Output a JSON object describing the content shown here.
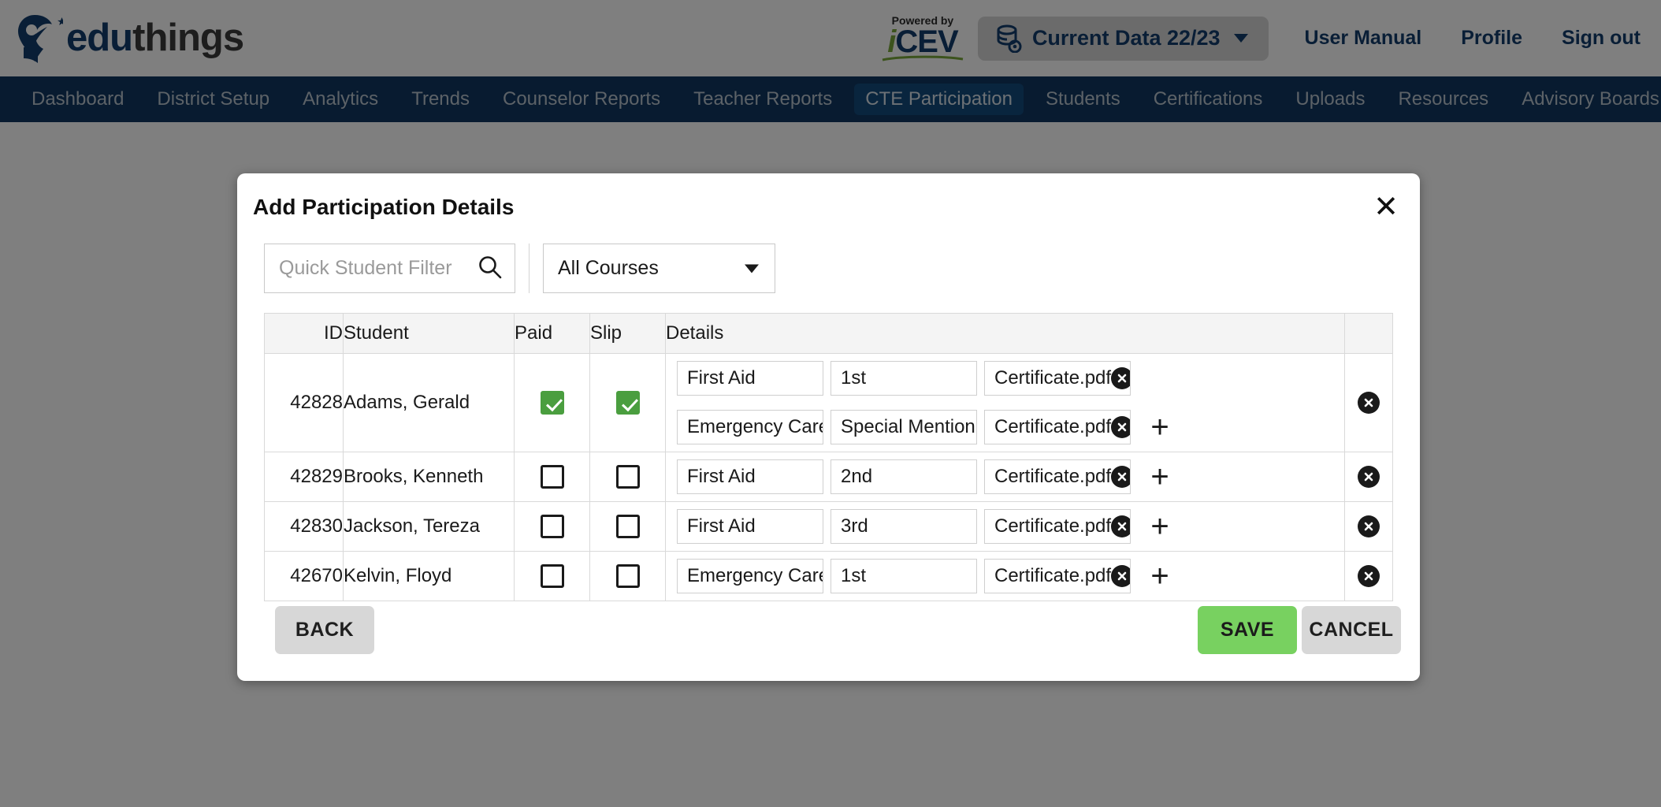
{
  "header": {
    "logo_text_blue": "edu",
    "logo_text_dark": "things",
    "logo_icon": "eduthings-pin-book-logo",
    "powered_by": "Powered by",
    "icev_i": "i",
    "icev_cev": "CEV",
    "data_selector": {
      "label": "Current Data 22/23",
      "icon": "database-view-icon",
      "caret": "chevron-down-icon"
    },
    "links": [
      {
        "label": "User Manual",
        "name": "user-manual-link"
      },
      {
        "label": "Profile",
        "name": "profile-link"
      },
      {
        "label": "Sign out",
        "name": "sign-out-link"
      }
    ]
  },
  "nav": {
    "active": "CTE Participation",
    "items": [
      "Dashboard",
      "District Setup",
      "Analytics",
      "Trends",
      "Counselor Reports",
      "Teacher Reports",
      "CTE Participation",
      "Students",
      "Certifications",
      "Uploads",
      "Resources",
      "Advisory Boards"
    ]
  },
  "modal": {
    "title": "Add Participation Details",
    "close_icon": "close-icon",
    "search": {
      "placeholder": "Quick Student Filter",
      "value": "",
      "icon": "search-icon"
    },
    "course_filter": {
      "selected": "All Courses",
      "caret": "chevron-down-icon"
    },
    "table": {
      "columns": [
        "ID",
        "Student",
        "Paid",
        "Slip",
        "Details",
        ""
      ],
      "rows": [
        {
          "id": "42828",
          "student": "Adams, Gerald",
          "paid": true,
          "slip": true,
          "details": [
            {
              "course": "First Aid",
              "placement": "1st",
              "certificate": "Certificate.pdf",
              "has_add": false
            },
            {
              "course": "Emergency Care",
              "placement": "Special Mention",
              "certificate": "Certificate.pdf",
              "has_add": true
            }
          ],
          "remove_row": true
        },
        {
          "id": "42829",
          "student": "Brooks, Kenneth",
          "paid": false,
          "slip": false,
          "details": [
            {
              "course": "First Aid",
              "placement": "2nd",
              "certificate": "Certificate.pdf",
              "has_add": true
            }
          ],
          "remove_row": true
        },
        {
          "id": "42830",
          "student": "Jackson, Tereza",
          "paid": false,
          "slip": false,
          "details": [
            {
              "course": "First Aid",
              "placement": "3rd",
              "certificate": "Certificate.pdf",
              "has_add": true
            }
          ],
          "remove_row": true
        },
        {
          "id": "42670",
          "student": "Kelvin, Floyd",
          "paid": false,
          "slip": false,
          "details": [
            {
              "course": "Emergency Care",
              "placement": "1st",
              "certificate": "Certificate.pdf",
              "has_add": true
            }
          ],
          "remove_row": true
        }
      ]
    },
    "buttons": {
      "back": "BACK",
      "save": "SAVE",
      "cancel": "CANCEL"
    }
  },
  "colors": {
    "nav_bg": "#103660",
    "nav_active_bg": "#134a7c",
    "brand_blue": "#123d6d",
    "accent_green": "#4a9e3f",
    "save_green": "#78d160",
    "backdrop": "#7f7f7f"
  }
}
